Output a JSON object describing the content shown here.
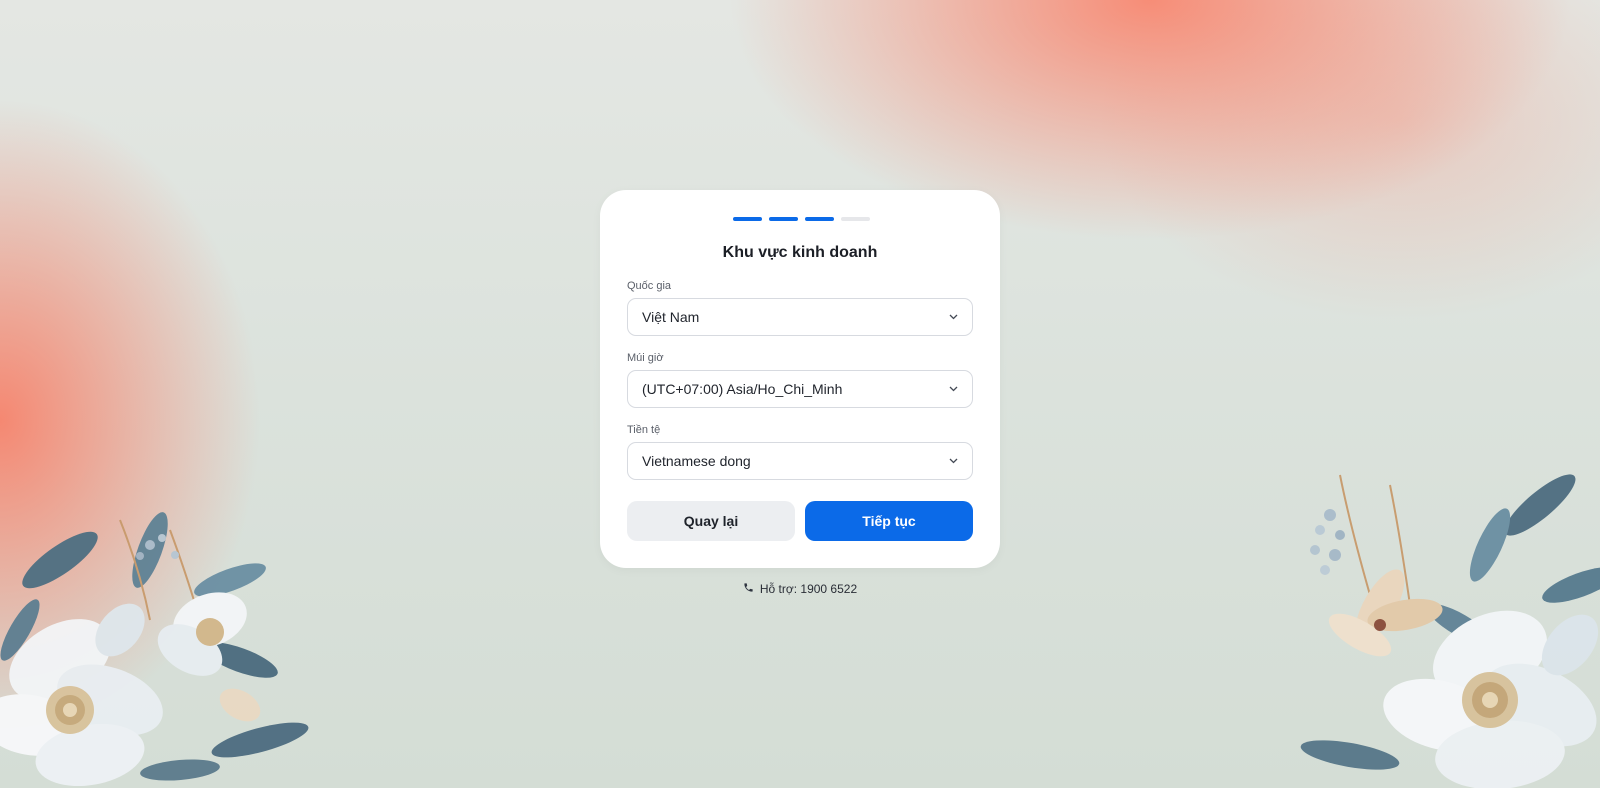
{
  "wizard": {
    "steps_total": 4,
    "steps_completed": 3
  },
  "card": {
    "title": "Khu vực kinh doanh"
  },
  "fields": {
    "country": {
      "label": "Quốc gia",
      "value": "Việt Nam"
    },
    "timezone": {
      "label": "Múi giờ",
      "value": "(UTC+07:00) Asia/Ho_Chi_Minh"
    },
    "currency": {
      "label": "Tiền tệ",
      "value": "Vietnamese dong"
    }
  },
  "buttons": {
    "back_label": "Quay lại",
    "next_label": "Tiếp tục"
  },
  "support": {
    "text": "Hỗ trợ: 1900 6522",
    "icon": "phone-icon"
  },
  "colors": {
    "accent": "#0b6ae8",
    "step_inactive": "#e6e7ea",
    "secondary_button": "#eceef1",
    "background_warm": "#f87c62",
    "background_cool": "#d8e0da"
  }
}
